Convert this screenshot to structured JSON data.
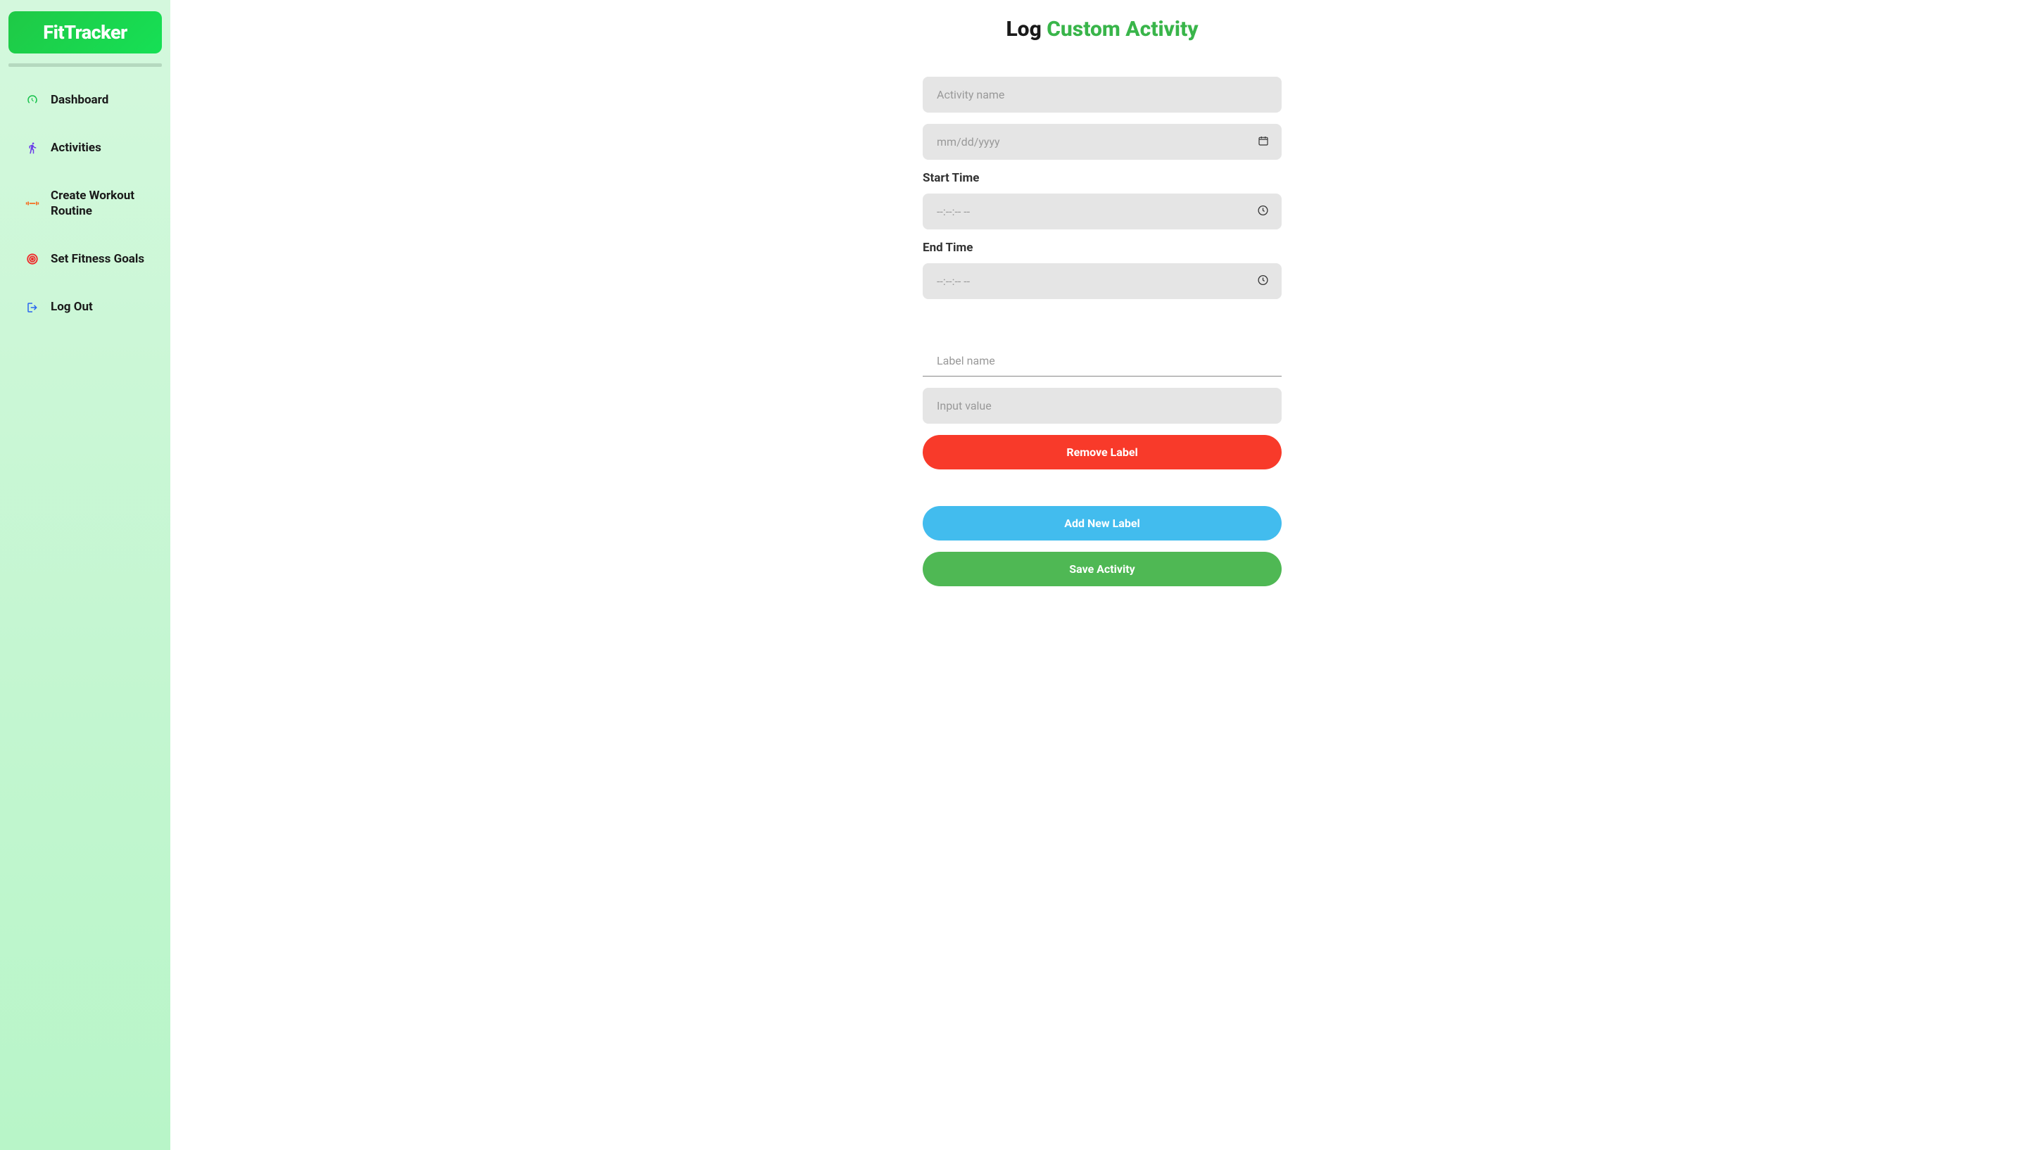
{
  "app": {
    "name": "FitTracker"
  },
  "sidebar": {
    "items": [
      {
        "label": "Dashboard",
        "icon": "dashboard"
      },
      {
        "label": "Activities",
        "icon": "running"
      },
      {
        "label": "Create Workout Routine",
        "icon": "dumbbell"
      },
      {
        "label": "Set Fitness Goals",
        "icon": "target"
      },
      {
        "label": "Log Out",
        "icon": "logout"
      }
    ]
  },
  "page": {
    "title_prefix": "Log ",
    "title_highlight": "Custom Activity"
  },
  "form": {
    "activity_name": {
      "placeholder": "Activity name"
    },
    "date": {
      "placeholder": "mm/dd/yyyy"
    },
    "start_time": {
      "label": "Start Time",
      "placeholder": "--:--:-- --"
    },
    "end_time": {
      "label": "End Time",
      "placeholder": "--:--:-- --"
    },
    "label_name": {
      "placeholder": "Label name"
    },
    "input_value": {
      "placeholder": "Input value"
    },
    "buttons": {
      "remove_label": "Remove Label",
      "add_label": "Add New Label",
      "save": "Save Activity"
    }
  }
}
